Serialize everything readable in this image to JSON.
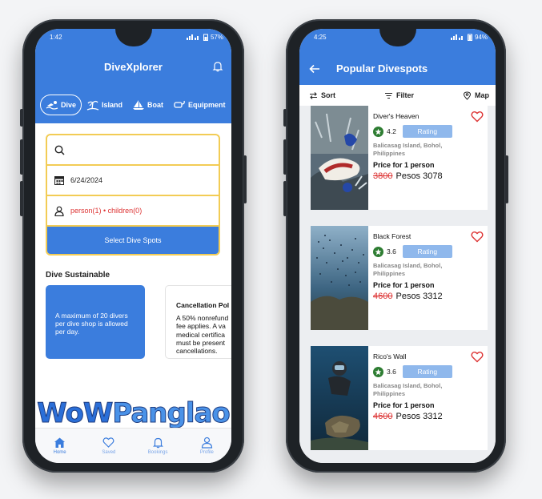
{
  "left_phone": {
    "status": {
      "time": "1:42",
      "battery": "57%"
    },
    "app_title": "DiveXplorer",
    "tabs": [
      {
        "label": "Dive",
        "icon": "swimmer-icon"
      },
      {
        "label": "Island",
        "icon": "island-icon"
      },
      {
        "label": "Boat",
        "icon": "sailboat-icon"
      },
      {
        "label": "Equipment",
        "icon": "equipment-icon"
      }
    ],
    "search": {
      "placeholder": ""
    },
    "date": "6/24/2024",
    "guests": "person(1) • children(0)",
    "select_button": "Select Dive Spots",
    "section_title": "Dive Sustainable",
    "card1": "A maximum of 20 divers per dive shop is allowed per day.",
    "card2": {
      "title": "Cancellation Pol",
      "lines": [
        "A 50% nonrefund",
        "fee applies. A va",
        "medical certifica",
        "must be present",
        "cancellations."
      ]
    },
    "logo": {
      "part1": "WoW",
      "part2": "Panglao"
    },
    "nav": [
      {
        "label": "Home",
        "icon": "home-icon"
      },
      {
        "label": "Saved",
        "icon": "heart-icon"
      },
      {
        "label": "Bookings",
        "icon": "bell-icon"
      },
      {
        "label": "Profile",
        "icon": "user-icon"
      }
    ]
  },
  "right_phone": {
    "status": {
      "time": "4:25",
      "battery": "94%"
    },
    "title": "Popular Divespots",
    "tools": {
      "sort": "Sort",
      "filter": "Filter",
      "map": "Map"
    },
    "spots": [
      {
        "name": "Diver's Heaven",
        "rating": "4.2",
        "rating_label": "Rating",
        "location": "Balicasag Island, Bohol, Philippines",
        "price_label": "Price for 1 person",
        "old_price": "3800",
        "price": "Pesos 3078",
        "image": "nudibranch-photo"
      },
      {
        "name": "Black Forest",
        "rating": "3.6",
        "rating_label": "Rating",
        "location": "Balicasag Island, Bohol, Philippines",
        "price_label": "Price for 1 person",
        "old_price": "4600",
        "price": "Pesos 3312",
        "image": "fish-school-photo"
      },
      {
        "name": "Rico's Wall",
        "rating": "3.6",
        "rating_label": "Rating",
        "location": "Balicasag Island, Bohol, Philippines",
        "price_label": "Price for 1 person",
        "old_price": "4600",
        "price": "Pesos 3312",
        "image": "diver-turtle-photo"
      }
    ]
  },
  "colors": {
    "primary": "#3b7ddd",
    "form_border": "#f2cc55",
    "strike_red": "#d33333",
    "star_green": "#2e7d32"
  }
}
